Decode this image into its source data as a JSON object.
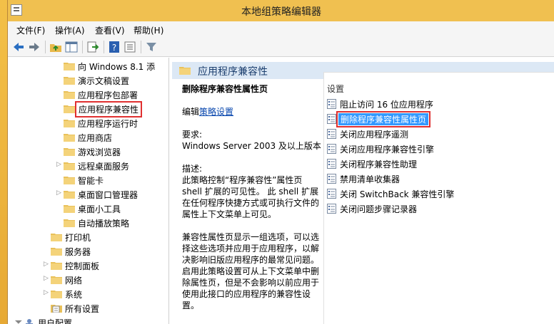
{
  "window": {
    "title": "本地组策略编辑器"
  },
  "menu": [
    "文件(F)",
    "操作(A)",
    "查看(V)",
    "帮助(H)"
  ],
  "toolbar": {
    "icons": [
      "back-arrow-icon",
      "forward-arrow-icon",
      "up-folder-icon",
      "show-hide-tree-icon",
      "export-list-icon",
      "help-icon",
      "properties-icon",
      "filter-icon"
    ]
  },
  "tree": {
    "items": [
      {
        "label": "向 Windows 8.1 添",
        "level": 2,
        "expandable": false
      },
      {
        "label": "演示文稿设置",
        "level": 2,
        "expandable": false
      },
      {
        "label": "应用程序包部署",
        "level": 2,
        "expandable": false
      },
      {
        "label": "应用程序兼容性",
        "level": 2,
        "expandable": false,
        "selected": true
      },
      {
        "label": "应用程序运行时",
        "level": 2,
        "expandable": false
      },
      {
        "label": "应用商店",
        "level": 2,
        "expandable": false
      },
      {
        "label": "游戏浏览器",
        "level": 2,
        "expandable": false
      },
      {
        "label": "远程桌面服务",
        "level": 2,
        "expandable": true
      },
      {
        "label": "智能卡",
        "level": 2,
        "expandable": false
      },
      {
        "label": "桌面窗口管理器",
        "level": 2,
        "expandable": true
      },
      {
        "label": "桌面小工具",
        "level": 2,
        "expandable": false
      },
      {
        "label": "自动播放策略",
        "level": 2,
        "expandable": false
      },
      {
        "label": "打印机",
        "level": 1,
        "expandable": false
      },
      {
        "label": "服务器",
        "level": 1,
        "expandable": false
      },
      {
        "label": "控制面板",
        "level": 1,
        "expandable": true
      },
      {
        "label": "网络",
        "level": 1,
        "expandable": true
      },
      {
        "label": "系统",
        "level": 1,
        "expandable": true
      },
      {
        "label": "所有设置",
        "level": 1,
        "expandable": false
      },
      {
        "label": "用户配置",
        "level": 0,
        "expandable": true
      }
    ]
  },
  "section": {
    "title": "应用程序兼容性"
  },
  "description": {
    "policy_name": "删除程序兼容性属性页",
    "edit_prefix": "编辑",
    "edit_link": "策略设置",
    "requirement_label": "要求:",
    "requirement_value": "Windows Server 2003 及以上版本",
    "desc_label": "描述:",
    "desc_p1": "此策略控制“程序兼容性”属性页 shell 扩展的可见性。 此 shell 扩展在任何程序快捷方式或可执行文件的属性上下文菜单上可见。",
    "desc_p2": "兼容性属性页显示一组选项，可以选择这些选项并应用于应用程序，以解决影响旧版应用程序的最常见问题。启用此策略设置可从上下文菜单中删除属性页，但是不会影响以前应用于使用此接口的应用程序的兼容性设置。"
  },
  "settings": {
    "header": "设置",
    "items": [
      {
        "label": "阻止访问 16 位应用程序"
      },
      {
        "label": "删除程序兼容性属性页",
        "selected": true
      },
      {
        "label": "关闭应用程序遥测"
      },
      {
        "label": "关闭应用程序兼容性引擎"
      },
      {
        "label": "关闭程序兼容性助理"
      },
      {
        "label": "禁用清单收集器"
      },
      {
        "label": "关闭 SwitchBack 兼容性引擎"
      },
      {
        "label": "关闭问题步骤记录器"
      }
    ]
  },
  "colors": {
    "title_bar": "#f0c050",
    "section_header": "#dce8f5",
    "selection": "#3399ff",
    "highlight_box": "#e03030",
    "link": "#0645ad"
  }
}
